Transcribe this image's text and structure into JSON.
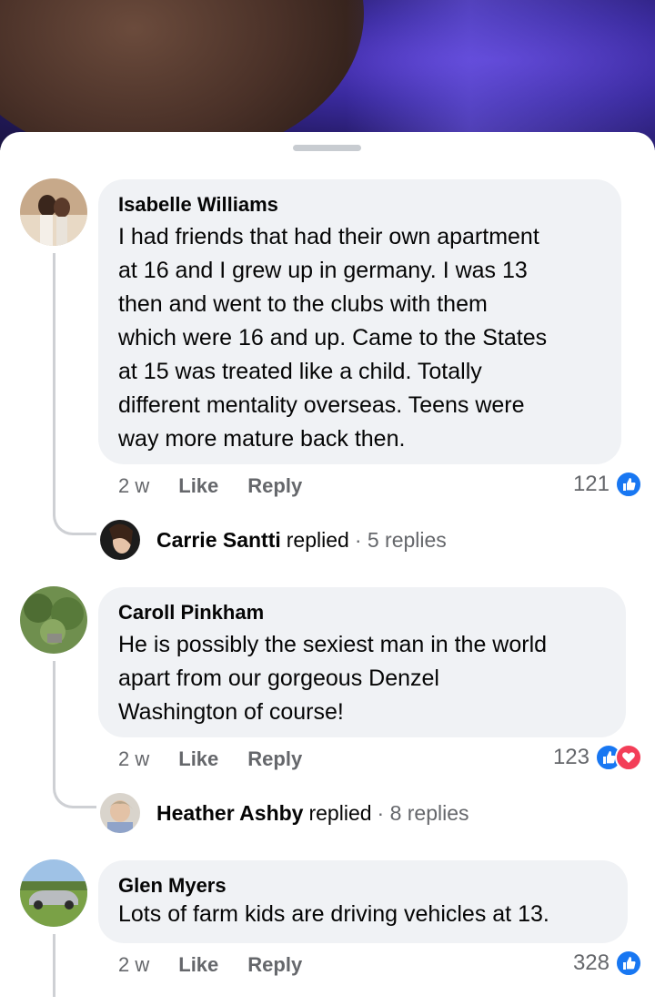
{
  "comments": [
    {
      "author": "Isabelle Williams",
      "lines": [
        "I had friends that had their own apartment",
        "at 16 and I grew up in germany. I was 13",
        "then and went to the clubs with them",
        "which were 16 and up. Came to the States",
        "at 15 was treated like a child. Totally",
        "different mentality overseas. Teens were",
        "way more mature back then."
      ],
      "time": "2 w",
      "like_label": "Like",
      "reply_label": "Reply",
      "reaction_count": "121",
      "reactions": [
        "like-icon"
      ],
      "reply_summary": {
        "name": "Carrie Santti",
        "word": "replied",
        "count": "· 5 replies"
      }
    },
    {
      "author": "Caroll Pinkham",
      "lines": [
        "He is possibly the sexiest man in the world",
        "apart from our gorgeous Denzel",
        "Washington of course!"
      ],
      "time": "2 w",
      "like_label": "Like",
      "reply_label": "Reply",
      "reaction_count": "123",
      "reactions": [
        "like-icon",
        "love-icon"
      ],
      "reply_summary": {
        "name": "Heather Ashby",
        "word": "replied",
        "count": "· 8 replies"
      }
    },
    {
      "author": "Glen Myers",
      "lines": [
        "Lots of farm kids are driving vehicles at 13."
      ],
      "time": "2 w",
      "like_label": "Like",
      "reply_label": "Reply",
      "reaction_count": "328",
      "reactions": [
        "like-icon"
      ]
    }
  ],
  "colors": {
    "like": "#1877f2",
    "love": "#f33e58",
    "bubble": "#f0f2f5",
    "meta_text": "#65676b"
  }
}
